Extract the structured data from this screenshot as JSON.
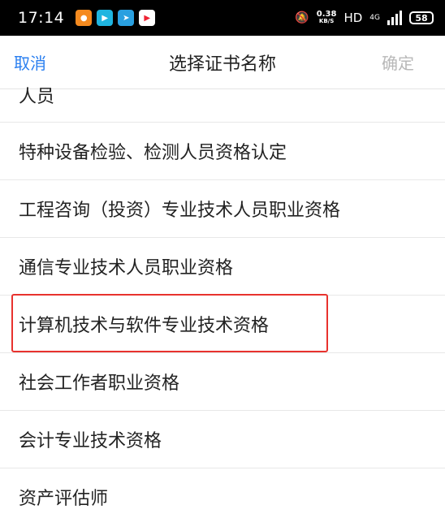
{
  "status_bar": {
    "time": "17:14",
    "speed_value": "0.38",
    "speed_unit": "KB/S",
    "hd": "HD",
    "network": "4G",
    "battery": "58"
  },
  "nav": {
    "cancel": "取消",
    "title": "选择证书名称",
    "confirm": "确定"
  },
  "list": {
    "items": [
      "人员",
      "特种设备检验、检测人员资格认定",
      "工程咨询（投资）专业技术人员职业资格",
      "通信专业技术人员职业资格",
      "计算机技术与软件专业技术资格",
      "社会工作者职业资格",
      "会计专业技术资格",
      "资产评估师"
    ]
  },
  "colors": {
    "accent": "#2a7ff0",
    "highlight": "#e8322e",
    "disabled": "#b8b8b8"
  }
}
